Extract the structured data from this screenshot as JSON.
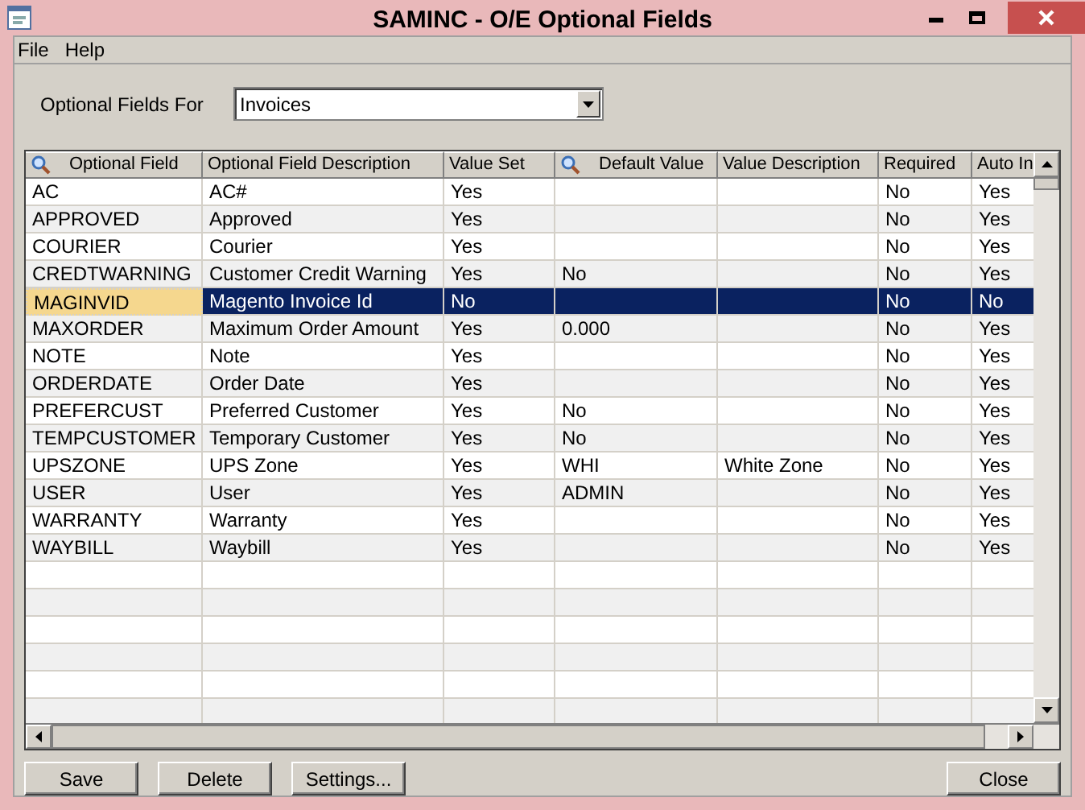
{
  "window": {
    "title": "SAMINC - O/E Optional Fields"
  },
  "menu": [
    "File",
    "Help"
  ],
  "filter": {
    "label": "Optional Fields For",
    "value": "Invoices"
  },
  "table": {
    "columns": [
      {
        "label": "Optional Field",
        "search": true
      },
      {
        "label": "Optional Field Description",
        "search": false
      },
      {
        "label": "Value Set",
        "search": false
      },
      {
        "label": "Default Value",
        "search": true
      },
      {
        "label": "Value Description",
        "search": false
      },
      {
        "label": "Required",
        "search": false
      },
      {
        "label": "Auto In",
        "search": false
      }
    ],
    "rows": [
      {
        "cells": [
          "AC",
          "AC#",
          "Yes",
          "",
          "",
          "No",
          "Yes"
        ],
        "selected": false
      },
      {
        "cells": [
          "APPROVED",
          "Approved",
          "Yes",
          "",
          "",
          "No",
          "Yes"
        ],
        "selected": false
      },
      {
        "cells": [
          "COURIER",
          "Courier",
          "Yes",
          "",
          "",
          "No",
          "Yes"
        ],
        "selected": false
      },
      {
        "cells": [
          "CREDTWARNING",
          "Customer Credit Warning",
          "Yes",
          "No",
          "",
          "No",
          "Yes"
        ],
        "selected": false
      },
      {
        "cells": [
          "MAGINVID",
          "Magento Invoice Id",
          "No",
          "",
          "",
          "No",
          "No"
        ],
        "selected": true
      },
      {
        "cells": [
          "MAXORDER",
          "Maximum Order Amount",
          "Yes",
          "0.000",
          "",
          "No",
          "Yes"
        ],
        "selected": false
      },
      {
        "cells": [
          "NOTE",
          "Note",
          "Yes",
          "",
          "",
          "No",
          "Yes"
        ],
        "selected": false
      },
      {
        "cells": [
          "ORDERDATE",
          "Order Date",
          "Yes",
          "",
          "",
          "No",
          "Yes"
        ],
        "selected": false
      },
      {
        "cells": [
          "PREFERCUST",
          "Preferred Customer",
          "Yes",
          "No",
          "",
          "No",
          "Yes"
        ],
        "selected": false
      },
      {
        "cells": [
          "TEMPCUSTOMER",
          "Temporary Customer",
          "Yes",
          "No",
          "",
          "No",
          "Yes"
        ],
        "selected": false
      },
      {
        "cells": [
          "UPSZONE",
          "UPS Zone",
          "Yes",
          "WHI",
          "White Zone",
          "No",
          "Yes"
        ],
        "selected": false
      },
      {
        "cells": [
          "USER",
          "User",
          "Yes",
          "ADMIN",
          "",
          "No",
          "Yes"
        ],
        "selected": false
      },
      {
        "cells": [
          "WARRANTY",
          "Warranty",
          "Yes",
          "",
          "",
          "No",
          "Yes"
        ],
        "selected": false
      },
      {
        "cells": [
          "WAYBILL",
          "Waybill",
          "Yes",
          "",
          "",
          "No",
          "Yes"
        ],
        "selected": false
      }
    ]
  },
  "buttons_left": [
    "Save",
    "Delete",
    "Settings..."
  ],
  "buttons_right": [
    "Close"
  ]
}
